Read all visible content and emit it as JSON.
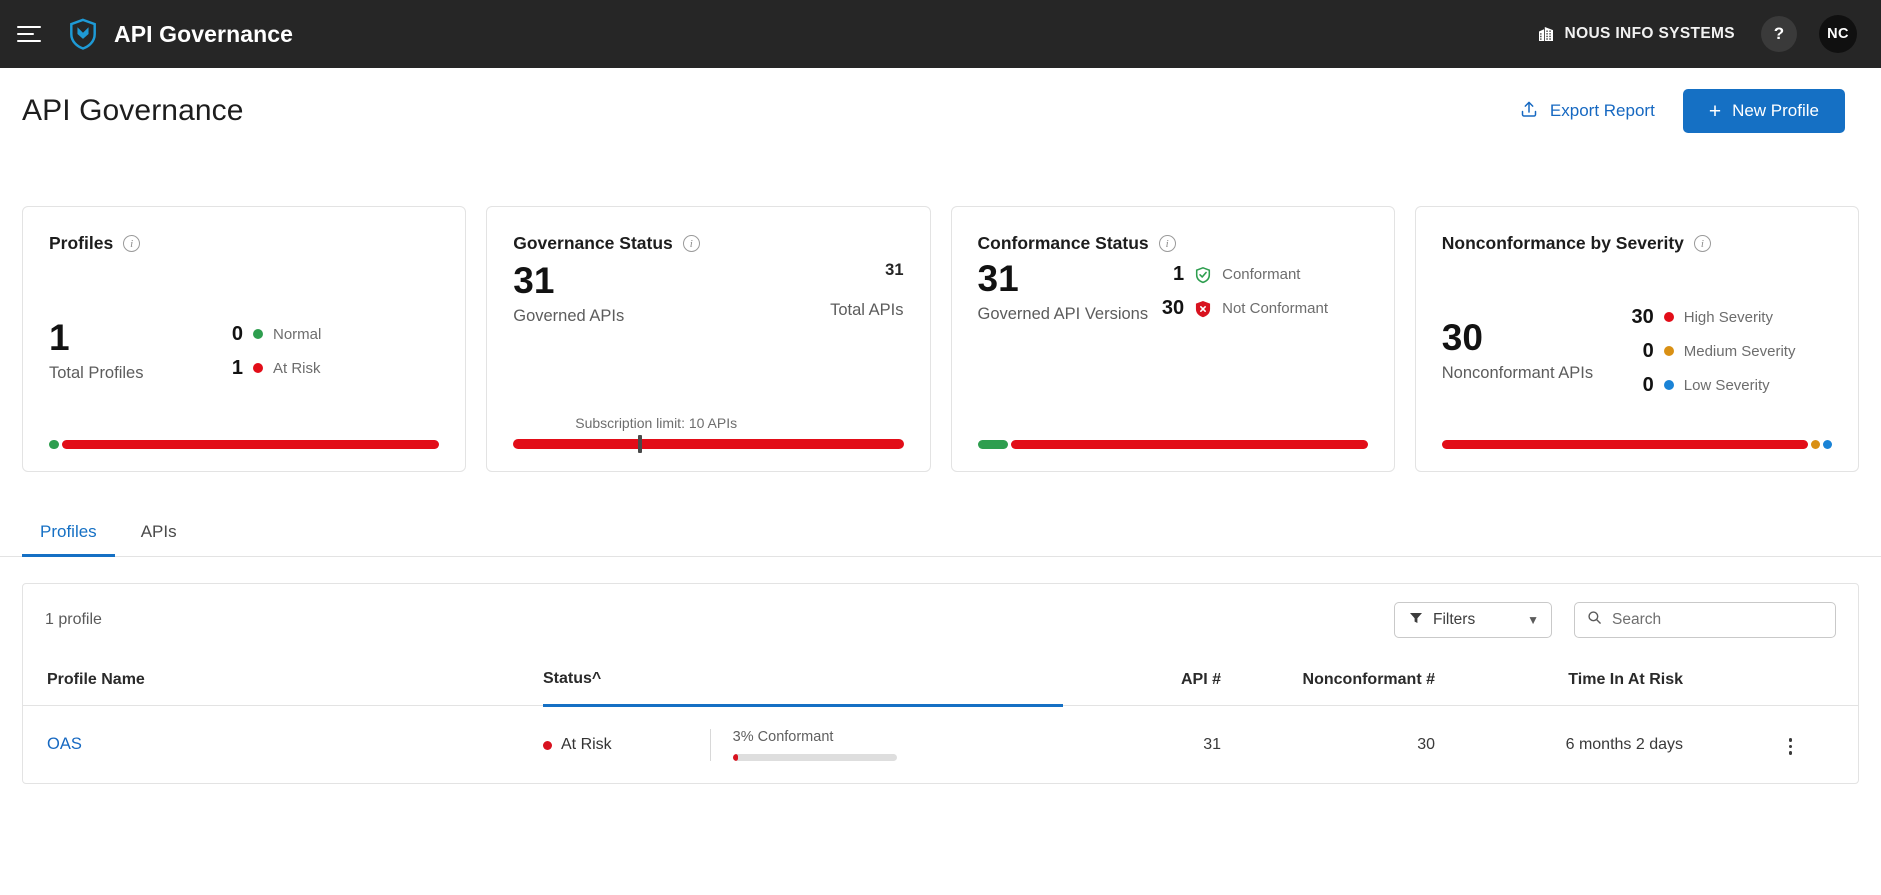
{
  "topbar": {
    "menu_icon": "hamburger-icon",
    "logo_icon": "shield-logo-icon",
    "title": "API Governance",
    "org_icon": "building-icon",
    "org_name": "NOUS INFO SYSTEMS",
    "help_label": "?",
    "avatar_initials": "NC",
    "background": "#262626"
  },
  "page_head": {
    "title": "API Governance",
    "export_label": "Export Report",
    "export_icon": "upload-icon",
    "new_profile_label": "New Profile",
    "new_profile_plus": "+",
    "accent": "#1570c4"
  },
  "cards": [
    {
      "title": "Profiles",
      "info_icon": "info-icon",
      "big_value": "1",
      "big_label": "Total Profiles",
      "legend": [
        {
          "value": "0",
          "label": "Normal",
          "color": "#2e9e4f"
        },
        {
          "value": "1",
          "label": "At Risk",
          "color": "#e20d18"
        }
      ]
    },
    {
      "title": "Governance Status",
      "info_icon": "info-icon",
      "big_value": "31",
      "big_label": "Governed APIs",
      "right_value": "31",
      "right_label": "Total APIs",
      "subscription_note": "Subscription limit: 10 APIs"
    },
    {
      "title": "Conformance Status",
      "info_icon": "info-icon",
      "big_value": "31",
      "big_label": "Governed API Versions",
      "legend": [
        {
          "value": "1",
          "label": "Conformant",
          "color": "#2e9e4f",
          "icon": "shield-check-icon"
        },
        {
          "value": "30",
          "label": "Not Conformant",
          "color": "#d8121f",
          "icon": "shield-x-icon"
        }
      ]
    },
    {
      "title": "Nonconformance by Severity",
      "info_icon": "info-icon",
      "big_value": "30",
      "big_label": "Nonconformant APIs",
      "legend": [
        {
          "value": "30",
          "label": "High Severity",
          "color": "#e20d18"
        },
        {
          "value": "0",
          "label": "Medium Severity",
          "color": "#d99014"
        },
        {
          "value": "0",
          "label": "Low Severity",
          "color": "#1a83d6"
        }
      ]
    }
  ],
  "tabs": [
    {
      "label": "Profiles",
      "active": true
    },
    {
      "label": "APIs",
      "active": false
    }
  ],
  "table": {
    "count_label": "1 profile",
    "filters_label": "Filters",
    "filters_icon": "funnel-icon",
    "filters_chevron": "chevron-down-icon",
    "search_placeholder": "Search",
    "search_value": "",
    "search_icon": "search-icon",
    "columns": [
      "Profile Name",
      "Status",
      "API #",
      "Nonconformant #",
      "Time In At Risk"
    ],
    "sort_indicator": "^",
    "sorted_column": "Status",
    "rows": [
      {
        "profile_name": "OAS",
        "status": "At Risk",
        "status_color": "#d8121f",
        "conformance_label": "3% Conformant",
        "conformance_pct": 3,
        "api_count": "31",
        "nonconformant_count": "30",
        "time_at_risk": "6 months 2 days",
        "menu_icon": "kebab-menu-icon"
      }
    ]
  }
}
